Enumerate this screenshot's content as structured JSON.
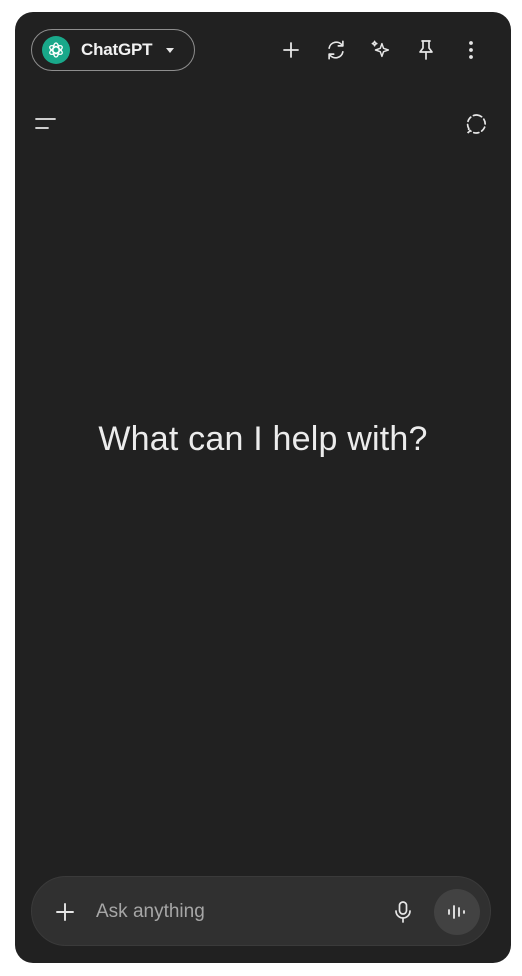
{
  "header": {
    "app_name": "ChatGPT",
    "icons": {
      "logo": "chatgpt-logo-icon",
      "dropdown": "chevron-down-icon",
      "new_chat": "plus-icon",
      "refresh": "refresh-icon",
      "sparkle": "sparkle-icon",
      "pin": "pin-icon",
      "more": "more-vertical-icon"
    }
  },
  "toolbar": {
    "menu_icon": "menu-icon",
    "temporary_chat_icon": "temporary-chat-icon"
  },
  "main": {
    "headline": "What can I help with?"
  },
  "composer": {
    "placeholder": "Ask anything",
    "value": "",
    "icons": {
      "add": "plus-icon",
      "mic": "microphone-icon",
      "voice": "voice-mode-icon"
    }
  },
  "colors": {
    "background": "#212121",
    "composer": "#303030",
    "accent": "#19a88a",
    "text": "#ececec"
  }
}
